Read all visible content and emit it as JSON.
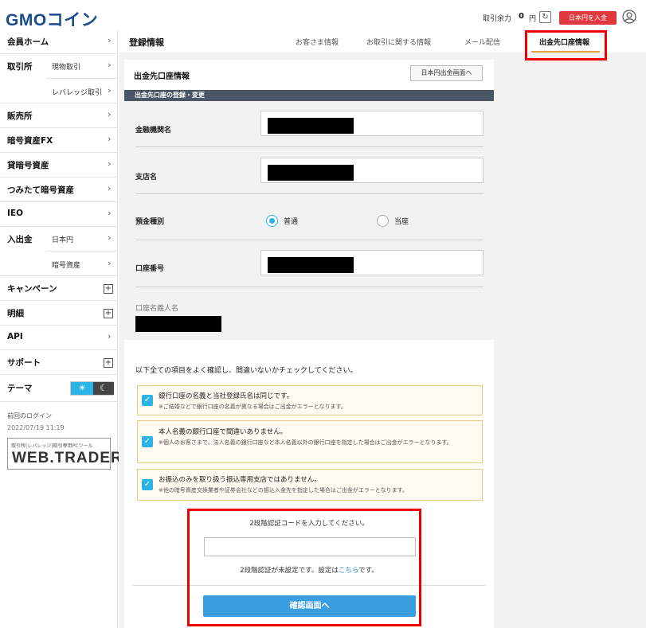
{
  "header": {
    "logo_main": "GMO",
    "logo_jp": "コイン",
    "balance_label": "取引余力",
    "balance_value": "0",
    "balance_unit": "円",
    "deposit_button": "日本円を入金"
  },
  "sidebar": {
    "items": [
      {
        "label": "会員ホーム"
      },
      {
        "label": "取引所",
        "sub": "現物取引"
      },
      {
        "label": "",
        "sub": "レバレッジ取引"
      },
      {
        "label": "販売所"
      },
      {
        "label": "暗号資産FX"
      },
      {
        "label": "貸暗号資産"
      },
      {
        "label": "つみたて暗号資産"
      },
      {
        "label": "IEO"
      },
      {
        "label": "入出金",
        "sub": "日本円"
      },
      {
        "label": "",
        "sub": "暗号資産"
      },
      {
        "label": "キャンペーン"
      },
      {
        "label": "明細"
      },
      {
        "label": "API"
      },
      {
        "label": "サポート"
      },
      {
        "label": "テーマ"
      }
    ],
    "last_login_label": "前回のログイン",
    "last_login_value": "2022/07/19 11:19",
    "webtrader_sub": "取引所(レバレッジ)取引専用PCツール",
    "webtrader_main": "WEB.TRADER"
  },
  "topnav": {
    "page_title": "登録情報",
    "tabs": [
      {
        "label": "お客さま情報"
      },
      {
        "label": "お取引に関する情報"
      },
      {
        "label": "メール配信"
      },
      {
        "label": "出金先口座情報"
      }
    ]
  },
  "card": {
    "title": "出金先口座情報",
    "jpy_withdraw_button": "日本円出金画面へ",
    "section_title": "出金先口座の登録・変更",
    "fields": {
      "bank_label": "金融機関名",
      "branch_label": "支店名",
      "account_type_label": "預金種別",
      "account_type_options": [
        "普通",
        "当座"
      ],
      "account_number_label": "口座番号",
      "holder_label": "口座名義人名"
    },
    "confirm_title": "以下全ての項目をよく確認し、間違いないかチェックしてください。",
    "checks": [
      {
        "main": "銀行口座の名義と当社登録氏名は同じです。",
        "sub": "※ご結婚などで銀行口座の名義が異なる場合はご出金がエラーとなります。"
      },
      {
        "main": "本人名義の銀行口座で間違いありません。",
        "sub": "※個人のお客さまで、法人名義の銀行口座など本人名義以外の銀行口座を指定した場合はご出金がエラーとなります。"
      },
      {
        "main": "お振込のみを取り扱う振込専用支店ではありません。",
        "sub": "※他の暗号資産交換業者や証券会社などの振込入金先を指定した場合はご出金がエラーとなります。"
      }
    ],
    "twofa_label": "2段階認証コードを入力してください。",
    "twofa_note_pre": "2段階認証が未設定です。設定は",
    "twofa_note_link": "こちら",
    "twofa_note_post": "です。",
    "submit_button": "確認画面へ"
  }
}
